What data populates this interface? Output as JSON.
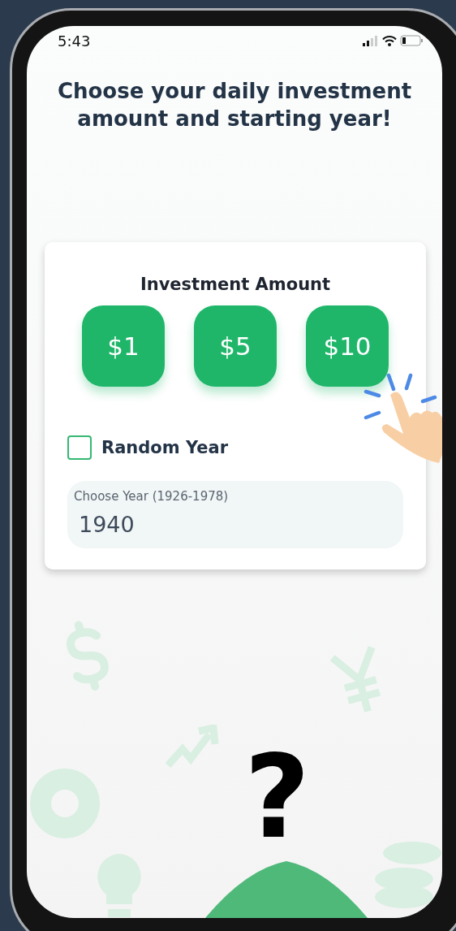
{
  "status_bar": {
    "time": "5:43"
  },
  "title": "Choose your daily investment amount and starting year!",
  "card": {
    "heading": "Investment Amount",
    "amount_buttons": [
      {
        "label": "$1"
      },
      {
        "label": "$5"
      },
      {
        "label": "$10"
      }
    ],
    "random_year": {
      "label": "Random Year",
      "checked": false
    },
    "year_field": {
      "label": "Choose Year (1926-1978)",
      "value": "1940"
    }
  },
  "question_mark": "?"
}
